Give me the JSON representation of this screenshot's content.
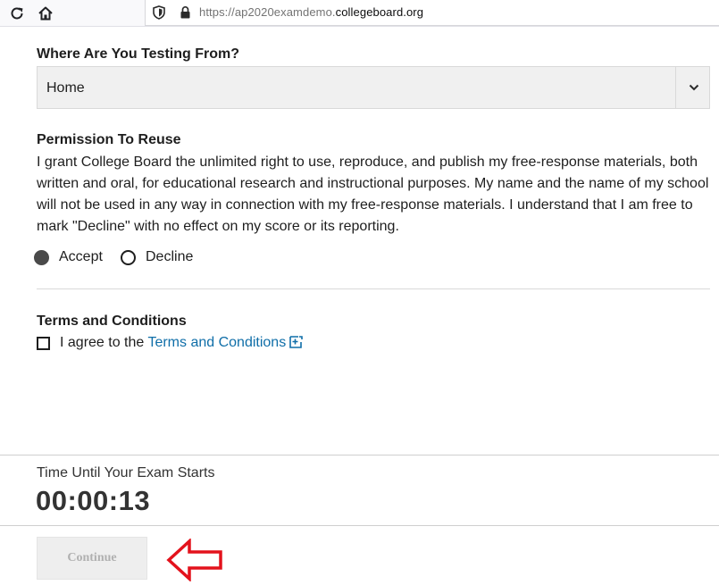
{
  "browser": {
    "url_prefix": "https://ap2020examdemo.",
    "url_domain": "collegeboard.org",
    "reload_icon": "reload-icon",
    "home_icon": "home-icon",
    "shield_icon": "shield-icon",
    "lock_icon": "lock-icon"
  },
  "testing_location": {
    "label": "Where Are You Testing From?",
    "selected_value": "Home",
    "chevron_icon": "chevron-down-icon"
  },
  "permission": {
    "label": "Permission To Reuse",
    "text": "I grant College Board the unlimited right to use, reproduce, and publish my free-response materials, both written and oral, for educational research and instructional purposes. My name and the name of my school will not be used in any way in connection with my free-response materials. I understand that I am free to mark \"Decline\" with no effect on my score or its reporting.",
    "options": [
      {
        "label": "Accept",
        "selected": true
      },
      {
        "label": "Decline",
        "selected": false
      }
    ]
  },
  "terms": {
    "label": "Terms and Conditions",
    "agree_prefix": "I agree to the ",
    "link_text": "Terms and Conditions",
    "checked": false,
    "external_icon": "external-link-icon"
  },
  "timer": {
    "label": "Time Until Your Exam Starts",
    "value": "00:00:13"
  },
  "footer": {
    "continue_label": "Continue",
    "annotation_icon": "red-arrow-left-icon"
  },
  "colors": {
    "link": "#0f6ea8",
    "annotation": "#e3121c",
    "disabled_text": "#b0b0b0"
  }
}
